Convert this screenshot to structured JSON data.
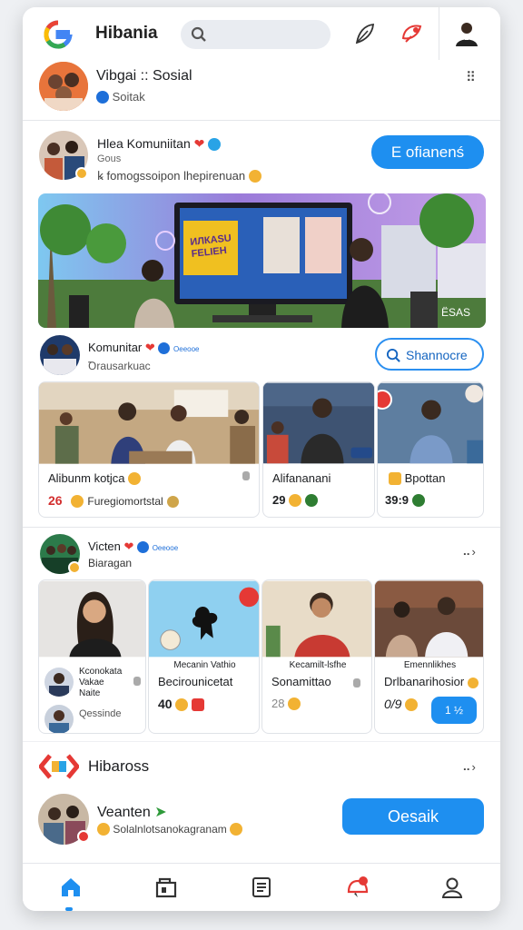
{
  "header": {
    "app_name": "Hibania",
    "search_placeholder": ""
  },
  "profile": {
    "name": "Vibgai :: Sosial",
    "sub": "Soitak"
  },
  "post1": {
    "name": "Hlea Komuniitan",
    "line2": "Gous",
    "line3": "ꝃ fomogssoipon lhepirenuan",
    "button": "Е ofianenś"
  },
  "banner": {
    "sign_text": "ИЛКАSU FELIEH",
    "badge": "ЁSAS"
  },
  "post2": {
    "name": "Komunitar",
    "tag": "Oeeooe",
    "sub": "Ꝺrausarkuac",
    "button": "Shannocre"
  },
  "row1": [
    {
      "title": "Alibunm kotjca",
      "count": "26",
      "meta": "Furegiomortstal"
    },
    {
      "title": "Alifananani",
      "count": "29",
      "meta": ""
    },
    {
      "title": "Bpottan",
      "count": "39:9",
      "meta": ""
    }
  ],
  "post3": {
    "name": "Victen",
    "tag": "Oeeooe",
    "sub": "Biaragan"
  },
  "row2": [
    {
      "lines": [
        "Kconokata",
        "Vakae",
        "Naite"
      ],
      "meta": "Qessinde"
    },
    {
      "lines": [
        "Mecanin Vathio"
      ],
      "title": "Becirounicetat",
      "count": "40"
    },
    {
      "lines": [
        "Kecamilt-lsfhe"
      ],
      "title": "Sonamittao",
      "count": "28"
    },
    {
      "lines": [
        "Emennlikhes"
      ],
      "title": "Drlbanarihosior",
      "count": "0/9",
      "button": "1 ½"
    }
  ],
  "section": {
    "title": "Hibaross"
  },
  "post4": {
    "name": "Veanten",
    "sub": "Solalnlotsanokagranam",
    "button": "Oesaik"
  },
  "nav": [
    "home",
    "store",
    "news",
    "notifications",
    "profile"
  ],
  "colors": {
    "accent": "#1e8ff0",
    "badge_red": "#e53935"
  }
}
